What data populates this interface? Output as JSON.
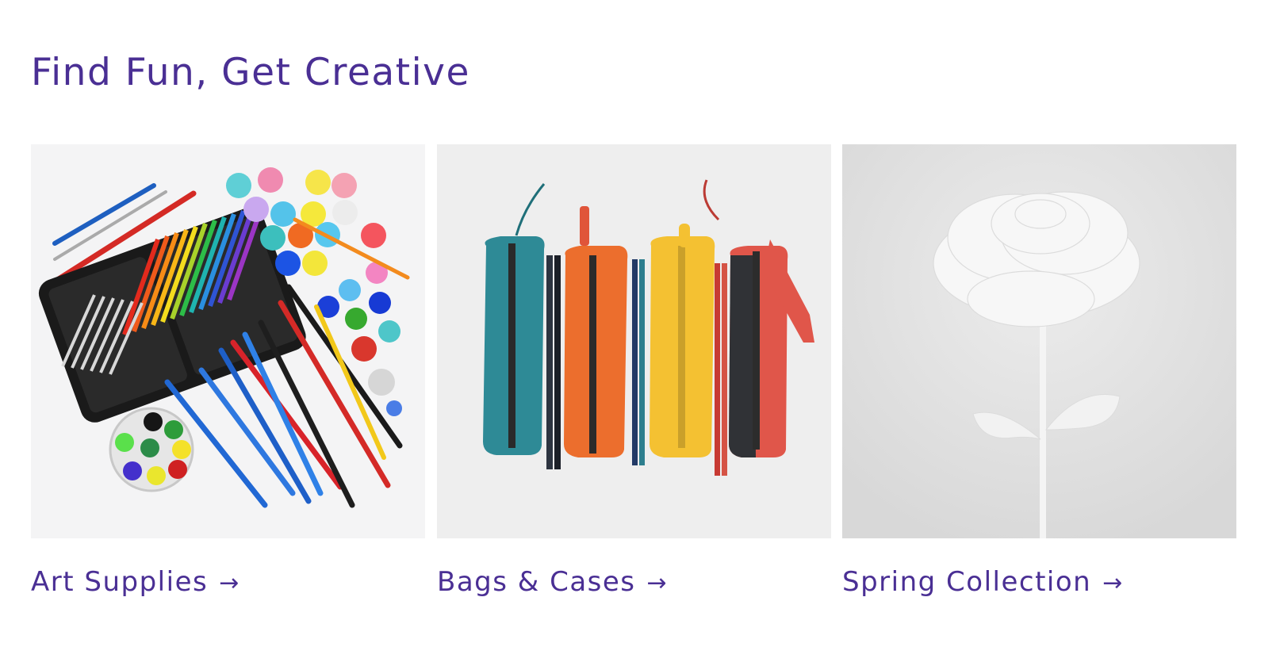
{
  "page": {
    "heading": "Find Fun, Get Creative",
    "accent_color": "#4a2f94"
  },
  "collections": [
    {
      "label": "Art Supplies",
      "arrow": "→",
      "image_icon": "art-supplies-image"
    },
    {
      "label": "Bags & Cases",
      "arrow": "→",
      "image_icon": "pencil-cases-image"
    },
    {
      "label": "Spring Collection",
      "arrow": "→",
      "image_icon": "white-rose-image"
    }
  ]
}
